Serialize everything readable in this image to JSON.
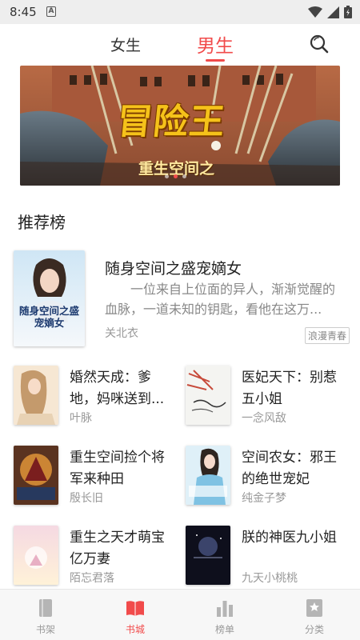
{
  "status_bar": {
    "time": "8:45",
    "notif_icon": "a-box-icon"
  },
  "top_tabs": {
    "girl": "女生",
    "boy": "男生",
    "active": "boy",
    "accent": "#f14b4b"
  },
  "banner": {
    "title": "冒险王",
    "subtitle": "重生空间之",
    "dots": 3,
    "active_dot": 1
  },
  "section": {
    "title": "推荐榜"
  },
  "featured": {
    "title": "随身空间之盛宠嫡女",
    "description": "一位来自上位面的异人，渐渐觉醒的血脉，一道未知的钥匙，看他在这万...",
    "author": "关北衣",
    "tag": "浪漫青春",
    "cover_text": "随身空间之盛宠嫡女"
  },
  "books": [
    {
      "title": "婚然天成：爹地，妈咪送到...",
      "author": "叶脉"
    },
    {
      "title": "医妃天下：别惹五小姐",
      "author": "一念风敌"
    },
    {
      "title": "重生空间捡个将军来种田",
      "author": "殷长旧"
    },
    {
      "title": "空间农女：邪王的绝世宠妃",
      "author": "纯金子梦"
    },
    {
      "title": "重生之天才萌宝亿万妻",
      "author": "陌忘君落"
    },
    {
      "title": "朕的神医九小姐",
      "author": "九天小桃桃"
    }
  ],
  "bottom_nav": [
    {
      "label": "书架",
      "icon": "bookshelf-icon"
    },
    {
      "label": "书城",
      "icon": "bookstore-icon",
      "active": true
    },
    {
      "label": "榜单",
      "icon": "chart-icon"
    },
    {
      "label": "分类",
      "icon": "category-icon"
    }
  ]
}
